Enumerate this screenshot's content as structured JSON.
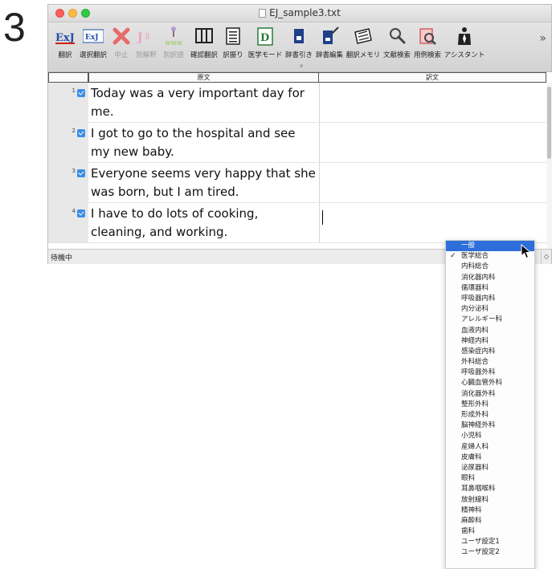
{
  "step_number": "3",
  "window": {
    "title": "EJ_sample3.txt"
  },
  "toolbar": {
    "items": [
      {
        "label": "翻訳",
        "icon": "exj-translate-icon",
        "enabled": true
      },
      {
        "label": "選択翻訳",
        "icon": "exj-select-translate-icon",
        "enabled": true
      },
      {
        "label": "中止",
        "icon": "stop-x-icon",
        "enabled": false
      },
      {
        "label": "別解釈",
        "icon": "alt-interpret-icon",
        "enabled": false
      },
      {
        "label": "別訳語",
        "icon": "alt-word-tree-icon",
        "enabled": false
      },
      {
        "label": "確認翻訳",
        "icon": "columns-icon",
        "enabled": true
      },
      {
        "label": "訳振り",
        "icon": "interlinear-icon",
        "enabled": true
      },
      {
        "label": "医学モード",
        "icon": "medical-mode-icon",
        "enabled": true
      },
      {
        "label": "辞書引き",
        "icon": "dictionary-lookup-icon",
        "enabled": true
      },
      {
        "label": "辞書編集",
        "icon": "dictionary-edit-icon",
        "enabled": true
      },
      {
        "label": "翻訳メモリ",
        "icon": "translation-memory-icon",
        "enabled": true
      },
      {
        "label": "文献検索",
        "icon": "literature-search-icon",
        "enabled": true
      },
      {
        "label": "用例検索",
        "icon": "example-search-icon",
        "enabled": true
      },
      {
        "label": "アシスタント",
        "icon": "assistant-icon",
        "enabled": true
      }
    ],
    "overflow": "»"
  },
  "grid": {
    "col_source": "原文",
    "col_target": "訳文",
    "rows": [
      {
        "num": "1",
        "source": "Today was a very important day for me.",
        "target": ""
      },
      {
        "num": "2",
        "source": "I got to go to the hospital and see my new baby.",
        "target": ""
      },
      {
        "num": "3",
        "source": "Everyone seems very happy that she was born, but I am tired.",
        "target": ""
      },
      {
        "num": "4",
        "source": "I have to do lots of cooking, cleaning, and working.",
        "target": ""
      }
    ]
  },
  "status": {
    "text": "待機中"
  },
  "dropdown": {
    "highlighted": "一般",
    "checked": "医学総合",
    "items": [
      "一般",
      "医学総合",
      "内科総合",
      "消化器内科",
      "循環器科",
      "呼吸器内科",
      "内分泌科",
      "アレルギー科",
      "血液内科",
      "神経内科",
      "感染症内科",
      "外科総合",
      "呼吸器外科",
      "心臓血管外科",
      "消化器外科",
      "整形外科",
      "形成外科",
      "脳神経外科",
      "小児科",
      "産婦人科",
      "皮膚科",
      "泌尿器科",
      "眼科",
      "耳鼻咽喉科",
      "放射線科",
      "精神科",
      "麻酔科",
      "歯科",
      "ユーザ設定1",
      "ユーザ設定2"
    ]
  },
  "colors": {
    "highlight": "#2d6ed8",
    "checkbox": "#3a8ee6"
  }
}
